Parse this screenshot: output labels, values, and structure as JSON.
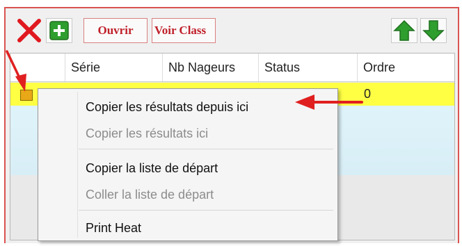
{
  "toolbar": {
    "delete_icon": "red-x-icon",
    "add_icon": "green-plus-icon",
    "open_label": "Ouvrir",
    "view_label": "Voir Class",
    "up_icon": "green-up-arrow-icon",
    "down_icon": "green-down-arrow-icon"
  },
  "grid": {
    "columns": [
      "Série",
      "Nb Nageurs",
      "Status",
      "Ordre"
    ],
    "row_ordre": "0"
  },
  "context_menu": {
    "items": [
      {
        "label": "Copier les résultats depuis ici",
        "enabled": true
      },
      {
        "label": "Copier les résultats ici",
        "enabled": false
      },
      {
        "label": "Copier la liste de départ",
        "enabled": true
      },
      {
        "label": "Coller la liste de départ",
        "enabled": false
      },
      {
        "label": "Print Heat",
        "enabled": true
      }
    ]
  },
  "colors": {
    "accent_red": "#c0202a",
    "highlight_row": "#ffff44",
    "annotation_arrow": "#e02020",
    "icon_green": "#2e9e2e"
  }
}
